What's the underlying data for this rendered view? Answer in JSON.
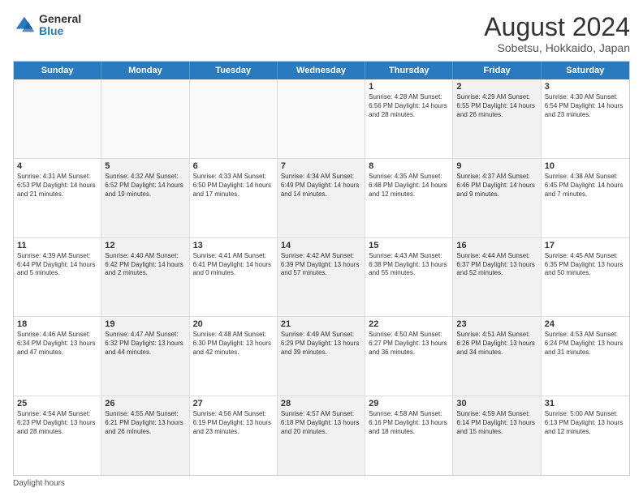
{
  "logo": {
    "general": "General",
    "blue": "Blue"
  },
  "title": "August 2024",
  "subtitle": "Sobetsu, Hokkaido, Japan",
  "days": [
    "Sunday",
    "Monday",
    "Tuesday",
    "Wednesday",
    "Thursday",
    "Friday",
    "Saturday"
  ],
  "weeks": [
    [
      {
        "day": "",
        "info": "",
        "shaded": false,
        "empty": true
      },
      {
        "day": "",
        "info": "",
        "shaded": false,
        "empty": true
      },
      {
        "day": "",
        "info": "",
        "shaded": false,
        "empty": true
      },
      {
        "day": "",
        "info": "",
        "shaded": false,
        "empty": true
      },
      {
        "day": "1",
        "info": "Sunrise: 4:28 AM\nSunset: 6:56 PM\nDaylight: 14 hours\nand 28 minutes.",
        "shaded": false,
        "empty": false
      },
      {
        "day": "2",
        "info": "Sunrise: 4:29 AM\nSunset: 6:55 PM\nDaylight: 14 hours\nand 26 minutes.",
        "shaded": true,
        "empty": false
      },
      {
        "day": "3",
        "info": "Sunrise: 4:30 AM\nSunset: 6:54 PM\nDaylight: 14 hours\nand 23 minutes.",
        "shaded": false,
        "empty": false
      }
    ],
    [
      {
        "day": "4",
        "info": "Sunrise: 4:31 AM\nSunset: 6:53 PM\nDaylight: 14 hours\nand 21 minutes.",
        "shaded": false,
        "empty": false
      },
      {
        "day": "5",
        "info": "Sunrise: 4:32 AM\nSunset: 6:52 PM\nDaylight: 14 hours\nand 19 minutes.",
        "shaded": true,
        "empty": false
      },
      {
        "day": "6",
        "info": "Sunrise: 4:33 AM\nSunset: 6:50 PM\nDaylight: 14 hours\nand 17 minutes.",
        "shaded": false,
        "empty": false
      },
      {
        "day": "7",
        "info": "Sunrise: 4:34 AM\nSunset: 6:49 PM\nDaylight: 14 hours\nand 14 minutes.",
        "shaded": true,
        "empty": false
      },
      {
        "day": "8",
        "info": "Sunrise: 4:35 AM\nSunset: 6:48 PM\nDaylight: 14 hours\nand 12 minutes.",
        "shaded": false,
        "empty": false
      },
      {
        "day": "9",
        "info": "Sunrise: 4:37 AM\nSunset: 6:46 PM\nDaylight: 14 hours\nand 9 minutes.",
        "shaded": true,
        "empty": false
      },
      {
        "day": "10",
        "info": "Sunrise: 4:38 AM\nSunset: 6:45 PM\nDaylight: 14 hours\nand 7 minutes.",
        "shaded": false,
        "empty": false
      }
    ],
    [
      {
        "day": "11",
        "info": "Sunrise: 4:39 AM\nSunset: 6:44 PM\nDaylight: 14 hours\nand 5 minutes.",
        "shaded": false,
        "empty": false
      },
      {
        "day": "12",
        "info": "Sunrise: 4:40 AM\nSunset: 6:42 PM\nDaylight: 14 hours\nand 2 minutes.",
        "shaded": true,
        "empty": false
      },
      {
        "day": "13",
        "info": "Sunrise: 4:41 AM\nSunset: 6:41 PM\nDaylight: 14 hours\nand 0 minutes.",
        "shaded": false,
        "empty": false
      },
      {
        "day": "14",
        "info": "Sunrise: 4:42 AM\nSunset: 6:39 PM\nDaylight: 13 hours\nand 57 minutes.",
        "shaded": true,
        "empty": false
      },
      {
        "day": "15",
        "info": "Sunrise: 4:43 AM\nSunset: 6:38 PM\nDaylight: 13 hours\nand 55 minutes.",
        "shaded": false,
        "empty": false
      },
      {
        "day": "16",
        "info": "Sunrise: 4:44 AM\nSunset: 6:37 PM\nDaylight: 13 hours\nand 52 minutes.",
        "shaded": true,
        "empty": false
      },
      {
        "day": "17",
        "info": "Sunrise: 4:45 AM\nSunset: 6:35 PM\nDaylight: 13 hours\nand 50 minutes.",
        "shaded": false,
        "empty": false
      }
    ],
    [
      {
        "day": "18",
        "info": "Sunrise: 4:46 AM\nSunset: 6:34 PM\nDaylight: 13 hours\nand 47 minutes.",
        "shaded": false,
        "empty": false
      },
      {
        "day": "19",
        "info": "Sunrise: 4:47 AM\nSunset: 6:32 PM\nDaylight: 13 hours\nand 44 minutes.",
        "shaded": true,
        "empty": false
      },
      {
        "day": "20",
        "info": "Sunrise: 4:48 AM\nSunset: 6:30 PM\nDaylight: 13 hours\nand 42 minutes.",
        "shaded": false,
        "empty": false
      },
      {
        "day": "21",
        "info": "Sunrise: 4:49 AM\nSunset: 6:29 PM\nDaylight: 13 hours\nand 39 minutes.",
        "shaded": true,
        "empty": false
      },
      {
        "day": "22",
        "info": "Sunrise: 4:50 AM\nSunset: 6:27 PM\nDaylight: 13 hours\nand 36 minutes.",
        "shaded": false,
        "empty": false
      },
      {
        "day": "23",
        "info": "Sunrise: 4:51 AM\nSunset: 6:26 PM\nDaylight: 13 hours\nand 34 minutes.",
        "shaded": true,
        "empty": false
      },
      {
        "day": "24",
        "info": "Sunrise: 4:53 AM\nSunset: 6:24 PM\nDaylight: 13 hours\nand 31 minutes.",
        "shaded": false,
        "empty": false
      }
    ],
    [
      {
        "day": "25",
        "info": "Sunrise: 4:54 AM\nSunset: 6:23 PM\nDaylight: 13 hours\nand 28 minutes.",
        "shaded": false,
        "empty": false
      },
      {
        "day": "26",
        "info": "Sunrise: 4:55 AM\nSunset: 6:21 PM\nDaylight: 13 hours\nand 26 minutes.",
        "shaded": true,
        "empty": false
      },
      {
        "day": "27",
        "info": "Sunrise: 4:56 AM\nSunset: 6:19 PM\nDaylight: 13 hours\nand 23 minutes.",
        "shaded": false,
        "empty": false
      },
      {
        "day": "28",
        "info": "Sunrise: 4:57 AM\nSunset: 6:18 PM\nDaylight: 13 hours\nand 20 minutes.",
        "shaded": true,
        "empty": false
      },
      {
        "day": "29",
        "info": "Sunrise: 4:58 AM\nSunset: 6:16 PM\nDaylight: 13 hours\nand 18 minutes.",
        "shaded": false,
        "empty": false
      },
      {
        "day": "30",
        "info": "Sunrise: 4:59 AM\nSunset: 6:14 PM\nDaylight: 13 hours\nand 15 minutes.",
        "shaded": true,
        "empty": false
      },
      {
        "day": "31",
        "info": "Sunrise: 5:00 AM\nSunset: 6:13 PM\nDaylight: 13 hours\nand 12 minutes.",
        "shaded": false,
        "empty": false
      }
    ]
  ],
  "footer": "Daylight hours"
}
